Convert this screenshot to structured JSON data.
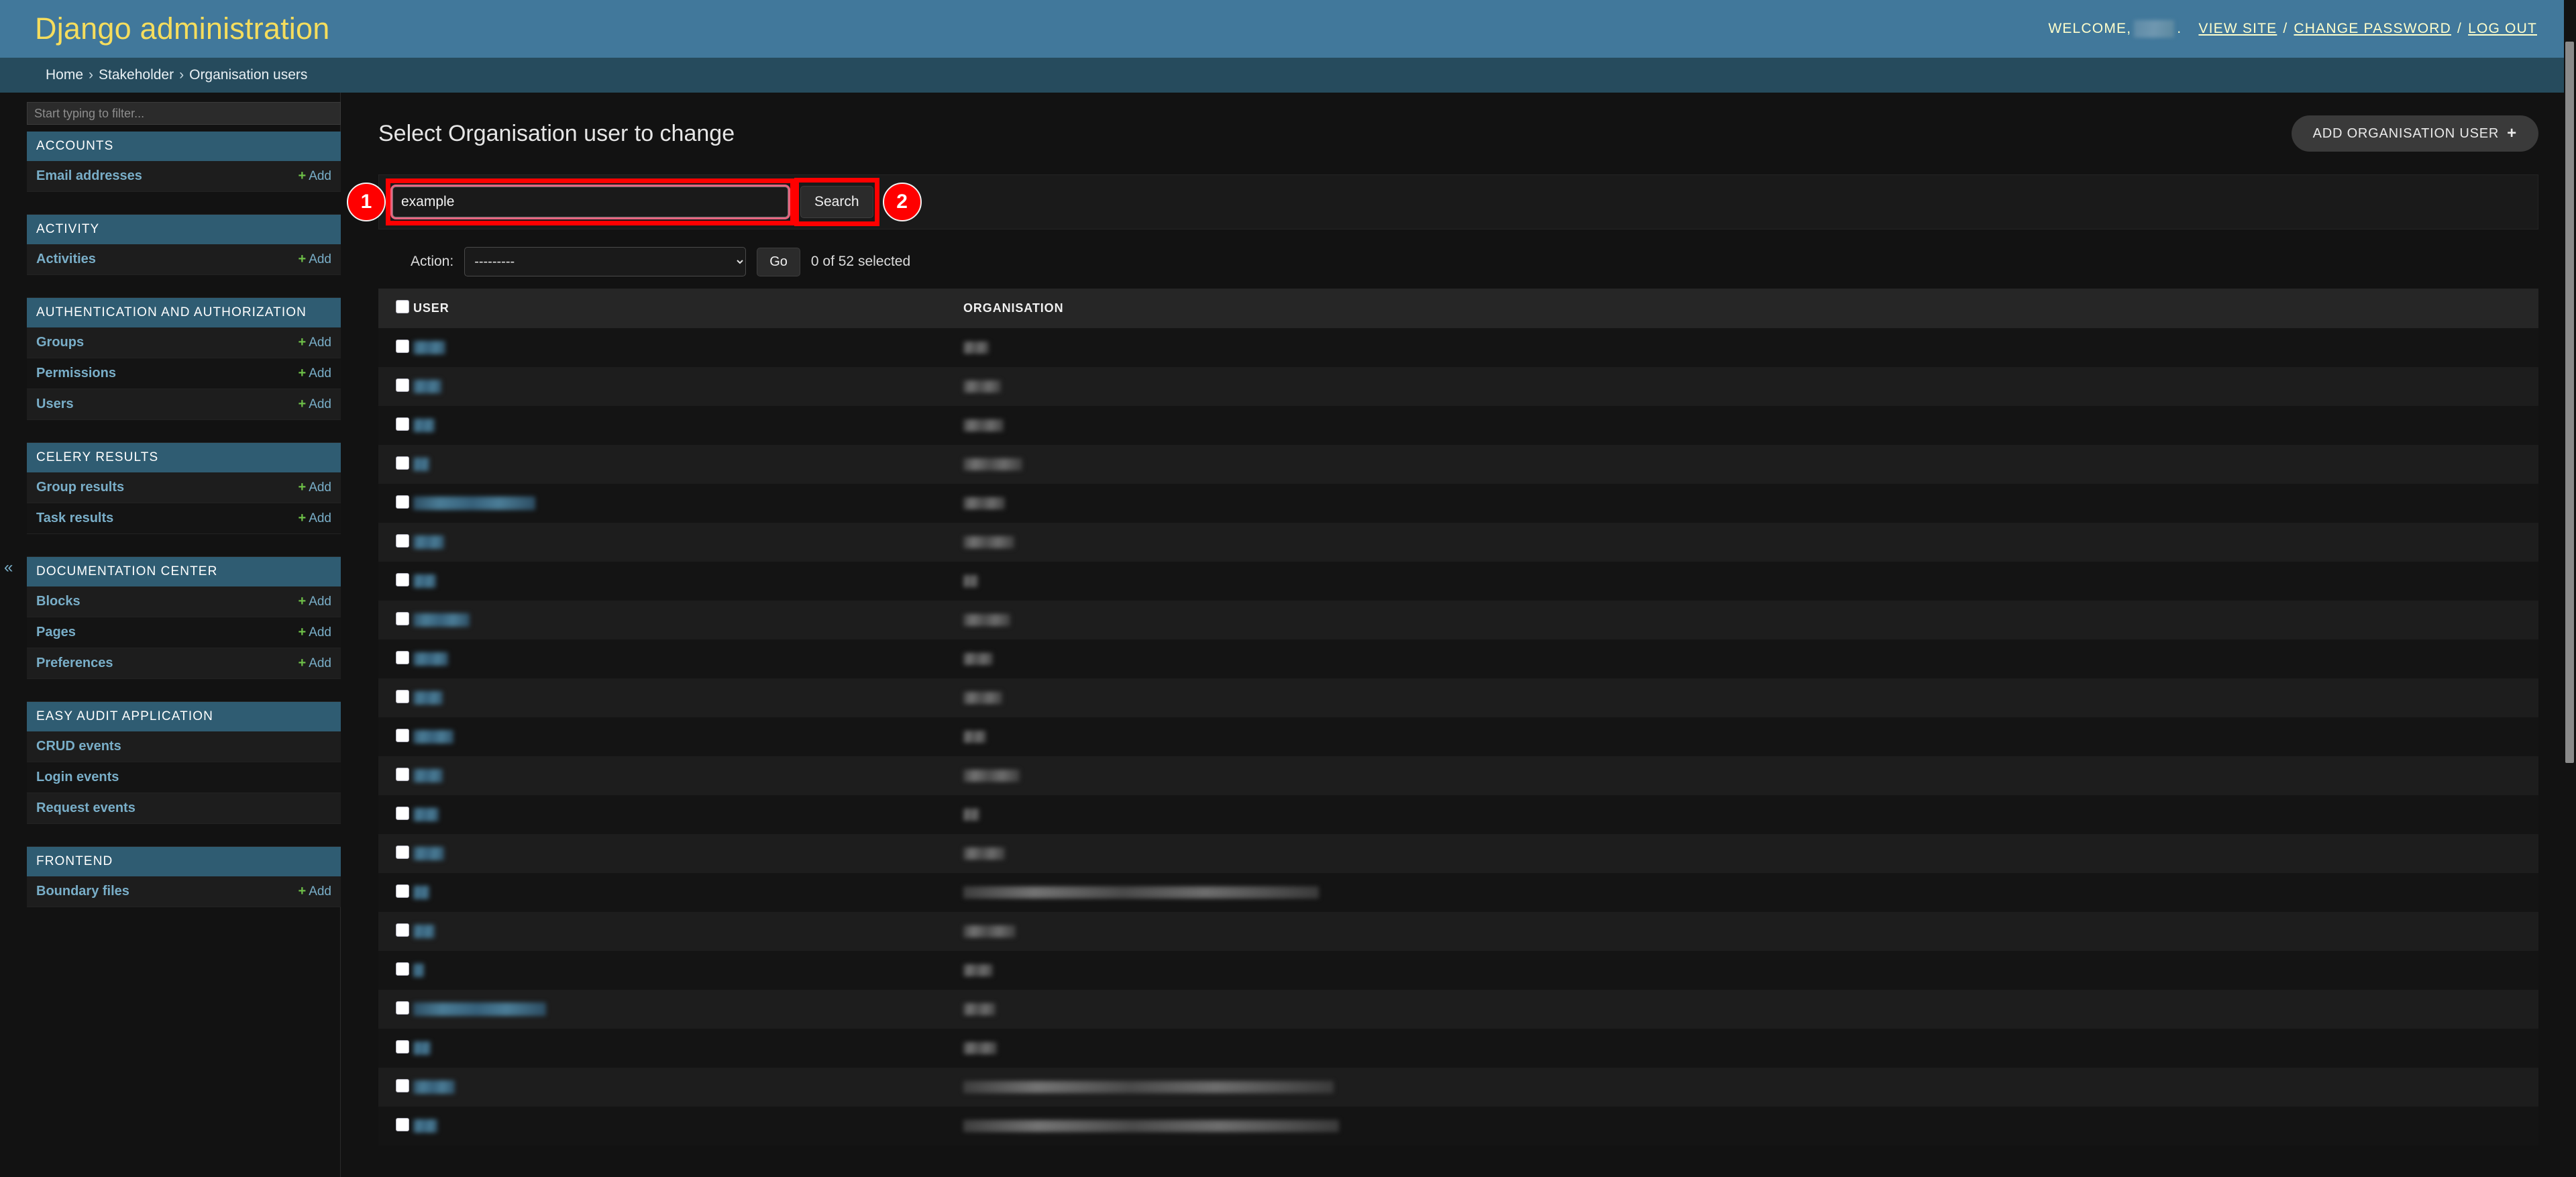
{
  "header": {
    "site_name": "Django administration",
    "welcome_prefix": "WELCOME,",
    "welcome_suffix": ".",
    "view_site": "VIEW SITE",
    "change_password": "CHANGE PASSWORD",
    "log_out": "LOG OUT",
    "separator": "/",
    "brand_color": "#41789b",
    "title_color": "#f5dd5d"
  },
  "breadcrumbs": {
    "chevron": "›",
    "items": [
      "Home",
      "Stakeholder",
      "Organisation users"
    ]
  },
  "sidebar": {
    "filter_placeholder": "Start typing to filter...",
    "collapse_icon": "«",
    "add_label": "Add",
    "plus": "+",
    "apps": [
      {
        "name": "ACCOUNTS",
        "models": [
          {
            "label": "Email addresses",
            "add": true
          }
        ]
      },
      {
        "name": "ACTIVITY",
        "models": [
          {
            "label": "Activities",
            "add": true
          }
        ]
      },
      {
        "name": "AUTHENTICATION AND AUTHORIZATION",
        "models": [
          {
            "label": "Groups",
            "add": true
          },
          {
            "label": "Permissions",
            "add": true
          },
          {
            "label": "Users",
            "add": true
          }
        ]
      },
      {
        "name": "CELERY RESULTS",
        "models": [
          {
            "label": "Group results",
            "add": true
          },
          {
            "label": "Task results",
            "add": true
          }
        ]
      },
      {
        "name": "DOCUMENTATION CENTER",
        "models": [
          {
            "label": "Blocks",
            "add": true
          },
          {
            "label": "Pages",
            "add": true
          },
          {
            "label": "Preferences",
            "add": true
          }
        ]
      },
      {
        "name": "EASY AUDIT APPLICATION",
        "models": [
          {
            "label": "CRUD events",
            "add": false
          },
          {
            "label": "Login events",
            "add": false
          },
          {
            "label": "Request events",
            "add": false
          }
        ]
      },
      {
        "name": "FRONTEND",
        "models": [
          {
            "label": "Boundary files",
            "add": true
          }
        ]
      }
    ]
  },
  "content": {
    "title": "Select Organisation user to change",
    "add_button": "ADD ORGANISATION USER",
    "add_button_icon": "+"
  },
  "search": {
    "value": "example",
    "submit_label": "Search"
  },
  "actions": {
    "label": "Action:",
    "selected": "---------",
    "options": [
      "---------"
    ],
    "go_label": "Go",
    "counter": "0 of 52 selected",
    "selected_count": 0,
    "total_count": 52
  },
  "table": {
    "columns": [
      "USER",
      "ORGANISATION"
    ],
    "rows": [
      {
        "user_w": 48,
        "org_w": 38
      },
      {
        "user_w": 42,
        "org_w": 56
      },
      {
        "user_w": 32,
        "org_w": 60
      },
      {
        "user_w": 24,
        "org_w": 88
      },
      {
        "user_w": 182,
        "org_w": 62
      },
      {
        "user_w": 46,
        "org_w": 76
      },
      {
        "user_w": 34,
        "org_w": 22
      },
      {
        "user_w": 84,
        "org_w": 70
      },
      {
        "user_w": 52,
        "org_w": 44
      },
      {
        "user_w": 44,
        "org_w": 58
      },
      {
        "user_w": 60,
        "org_w": 34
      },
      {
        "user_w": 44,
        "org_w": 84
      },
      {
        "user_w": 38,
        "org_w": 24
      },
      {
        "user_w": 46,
        "org_w": 62
      },
      {
        "user_w": 24,
        "org_w": 530
      },
      {
        "user_w": 32,
        "org_w": 78
      },
      {
        "user_w": 16,
        "org_w": 44
      },
      {
        "user_w": 198,
        "org_w": 48
      },
      {
        "user_w": 26,
        "org_w": 50
      },
      {
        "user_w": 62,
        "org_w": 552
      },
      {
        "user_w": 36,
        "org_w": 560
      }
    ]
  },
  "annotations": [
    {
      "number": "1"
    },
    {
      "number": "2"
    }
  ]
}
